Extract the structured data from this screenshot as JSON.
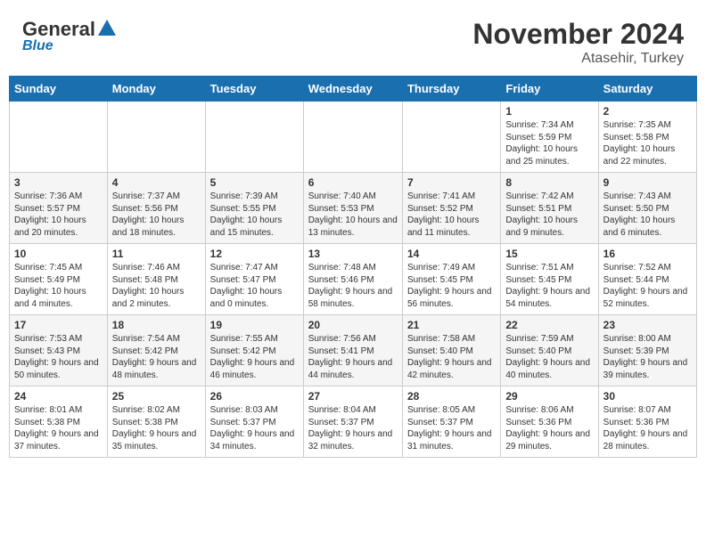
{
  "header": {
    "logo_main": "General",
    "logo_sub": "Blue",
    "title": "November 2024",
    "subtitle": "Atasehir, Turkey"
  },
  "days_of_week": [
    "Sunday",
    "Monday",
    "Tuesday",
    "Wednesday",
    "Thursday",
    "Friday",
    "Saturday"
  ],
  "weeks": [
    [
      {
        "day": "",
        "info": ""
      },
      {
        "day": "",
        "info": ""
      },
      {
        "day": "",
        "info": ""
      },
      {
        "day": "",
        "info": ""
      },
      {
        "day": "",
        "info": ""
      },
      {
        "day": "1",
        "info": "Sunrise: 7:34 AM\nSunset: 5:59 PM\nDaylight: 10 hours and 25 minutes."
      },
      {
        "day": "2",
        "info": "Sunrise: 7:35 AM\nSunset: 5:58 PM\nDaylight: 10 hours and 22 minutes."
      }
    ],
    [
      {
        "day": "3",
        "info": "Sunrise: 7:36 AM\nSunset: 5:57 PM\nDaylight: 10 hours and 20 minutes."
      },
      {
        "day": "4",
        "info": "Sunrise: 7:37 AM\nSunset: 5:56 PM\nDaylight: 10 hours and 18 minutes."
      },
      {
        "day": "5",
        "info": "Sunrise: 7:39 AM\nSunset: 5:55 PM\nDaylight: 10 hours and 15 minutes."
      },
      {
        "day": "6",
        "info": "Sunrise: 7:40 AM\nSunset: 5:53 PM\nDaylight: 10 hours and 13 minutes."
      },
      {
        "day": "7",
        "info": "Sunrise: 7:41 AM\nSunset: 5:52 PM\nDaylight: 10 hours and 11 minutes."
      },
      {
        "day": "8",
        "info": "Sunrise: 7:42 AM\nSunset: 5:51 PM\nDaylight: 10 hours and 9 minutes."
      },
      {
        "day": "9",
        "info": "Sunrise: 7:43 AM\nSunset: 5:50 PM\nDaylight: 10 hours and 6 minutes."
      }
    ],
    [
      {
        "day": "10",
        "info": "Sunrise: 7:45 AM\nSunset: 5:49 PM\nDaylight: 10 hours and 4 minutes."
      },
      {
        "day": "11",
        "info": "Sunrise: 7:46 AM\nSunset: 5:48 PM\nDaylight: 10 hours and 2 minutes."
      },
      {
        "day": "12",
        "info": "Sunrise: 7:47 AM\nSunset: 5:47 PM\nDaylight: 10 hours and 0 minutes."
      },
      {
        "day": "13",
        "info": "Sunrise: 7:48 AM\nSunset: 5:46 PM\nDaylight: 9 hours and 58 minutes."
      },
      {
        "day": "14",
        "info": "Sunrise: 7:49 AM\nSunset: 5:45 PM\nDaylight: 9 hours and 56 minutes."
      },
      {
        "day": "15",
        "info": "Sunrise: 7:51 AM\nSunset: 5:45 PM\nDaylight: 9 hours and 54 minutes."
      },
      {
        "day": "16",
        "info": "Sunrise: 7:52 AM\nSunset: 5:44 PM\nDaylight: 9 hours and 52 minutes."
      }
    ],
    [
      {
        "day": "17",
        "info": "Sunrise: 7:53 AM\nSunset: 5:43 PM\nDaylight: 9 hours and 50 minutes."
      },
      {
        "day": "18",
        "info": "Sunrise: 7:54 AM\nSunset: 5:42 PM\nDaylight: 9 hours and 48 minutes."
      },
      {
        "day": "19",
        "info": "Sunrise: 7:55 AM\nSunset: 5:42 PM\nDaylight: 9 hours and 46 minutes."
      },
      {
        "day": "20",
        "info": "Sunrise: 7:56 AM\nSunset: 5:41 PM\nDaylight: 9 hours and 44 minutes."
      },
      {
        "day": "21",
        "info": "Sunrise: 7:58 AM\nSunset: 5:40 PM\nDaylight: 9 hours and 42 minutes."
      },
      {
        "day": "22",
        "info": "Sunrise: 7:59 AM\nSunset: 5:40 PM\nDaylight: 9 hours and 40 minutes."
      },
      {
        "day": "23",
        "info": "Sunrise: 8:00 AM\nSunset: 5:39 PM\nDaylight: 9 hours and 39 minutes."
      }
    ],
    [
      {
        "day": "24",
        "info": "Sunrise: 8:01 AM\nSunset: 5:38 PM\nDaylight: 9 hours and 37 minutes."
      },
      {
        "day": "25",
        "info": "Sunrise: 8:02 AM\nSunset: 5:38 PM\nDaylight: 9 hours and 35 minutes."
      },
      {
        "day": "26",
        "info": "Sunrise: 8:03 AM\nSunset: 5:37 PM\nDaylight: 9 hours and 34 minutes."
      },
      {
        "day": "27",
        "info": "Sunrise: 8:04 AM\nSunset: 5:37 PM\nDaylight: 9 hours and 32 minutes."
      },
      {
        "day": "28",
        "info": "Sunrise: 8:05 AM\nSunset: 5:37 PM\nDaylight: 9 hours and 31 minutes."
      },
      {
        "day": "29",
        "info": "Sunrise: 8:06 AM\nSunset: 5:36 PM\nDaylight: 9 hours and 29 minutes."
      },
      {
        "day": "30",
        "info": "Sunrise: 8:07 AM\nSunset: 5:36 PM\nDaylight: 9 hours and 28 minutes."
      }
    ]
  ]
}
